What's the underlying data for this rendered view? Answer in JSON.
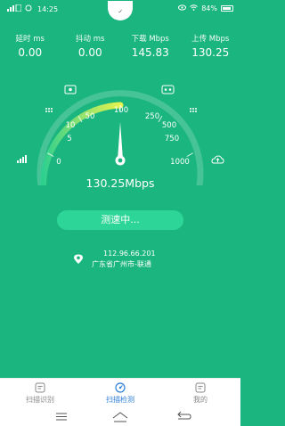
{
  "status_bar": {
    "time": "14:25",
    "battery": "84%"
  },
  "stats": [
    {
      "label": "延时 ms",
      "value": "0.00"
    },
    {
      "label": "抖动 ms",
      "value": "0.00"
    },
    {
      "label": "下载 Mbps",
      "value": "145.83"
    },
    {
      "label": "上传 Mbps",
      "value": "130.25"
    }
  ],
  "gauge": {
    "ticks": [
      "0",
      "5",
      "10",
      "50",
      "100",
      "250",
      "500",
      "750",
      "1000"
    ],
    "needle_value": 100,
    "progress_fraction": 0.5
  },
  "speed_readout": "130.25Mbps",
  "test_button": "测速中...",
  "location": {
    "ip": "112.96.66.201",
    "region": "广东省广州市-联通"
  },
  "tabs": [
    {
      "label": "扫描识别",
      "icon": "scan-icon"
    },
    {
      "label": "扫描检测",
      "icon": "dashboard-icon"
    },
    {
      "label": "我的",
      "icon": "profile-icon"
    }
  ],
  "colors": {
    "background": "#1bb57f",
    "button": "#2ed599",
    "active_tab": "#2e7fd8"
  }
}
